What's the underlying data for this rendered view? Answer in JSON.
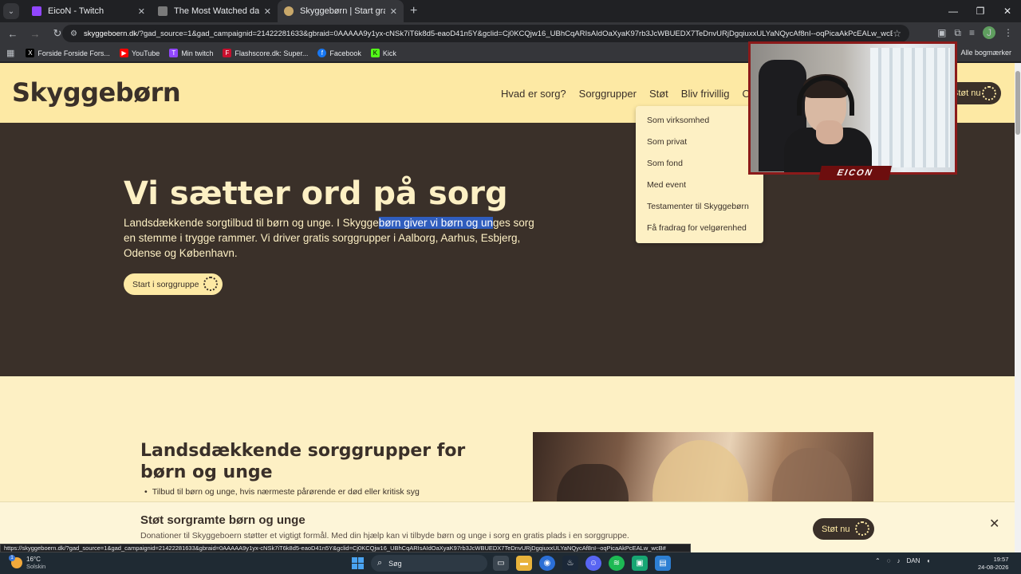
{
  "tabs": [
    {
      "title": "EicoN - Twitch",
      "favicon_color": "#9146ff"
    },
    {
      "title": "The Most Watched dansk Twitch",
      "favicon_color": "#7a7a7a"
    },
    {
      "title": "Skyggebørn | Start gratis i sorg",
      "favicon_color": "#c9a86a"
    }
  ],
  "browser": {
    "url_host": "skyggeboern.dk",
    "url_rest": "/?gad_source=1&gad_campaignid=21422281633&gbraid=0AAAAA9y1yx-cNSk7iT6k8d5-eaoD41n5Y&gclid=Cj0KCQjw16_UBhCqARIsAIdOaXyaK97rb3JcWBUEDX7TeDnvURjDgqiuxxULYaNQycAf8nI--oqPicaAkPcEALw_wcB",
    "profile_initial": "J",
    "status_url": "https://skyggeboern.dk/?gad_source=1&gad_campaignid=21422281633&gbraid=0AAAAA9y1yx-cNSk7iT6k8d5-eaoD41n5Y&gclid=Cj0KCQjw16_UBhCqARIsAIdOaXyaK97rb3JcWBUEDX7TeDnvURjDgqiuxxULYaNQycAf8nI--oqPicaAkPcEALw_wcB#"
  },
  "bookmarks": [
    {
      "label": "Forside Forside Fors...",
      "icon": "x-icon",
      "color": "#000000",
      "glyph": "X"
    },
    {
      "label": "YouTube",
      "icon": "youtube-icon",
      "color": "#ff0000",
      "glyph": "▶"
    },
    {
      "label": "Min twitch",
      "icon": "twitch-icon",
      "color": "#9146ff",
      "glyph": "T"
    },
    {
      "label": "Flashscore.dk: Super...",
      "icon": "flashscore-icon",
      "color": "#c8102e",
      "glyph": "F"
    },
    {
      "label": "Facebook",
      "icon": "facebook-icon",
      "color": "#1877f2",
      "glyph": "f"
    },
    {
      "label": "Kick",
      "icon": "kick-icon",
      "color": "#53fc18",
      "glyph": "K"
    }
  ],
  "bookmarks_all": "Alle bogmærker",
  "site": {
    "logo": "Skyggebørn",
    "nav": [
      "Hvad er sorg?",
      "Sorggrupper",
      "Støt",
      "Bliv frivillig",
      "Om"
    ],
    "header_cta": "Støt nu",
    "dropdown": [
      "Som virksomhed",
      "Som privat",
      "Som fond",
      "Med event",
      "Testamenter til Skyggebørn",
      "Få fradrag for velgørenhed"
    ],
    "hero": {
      "title": "Vi sætter ord på sorg",
      "text_before": "Landsdækkende sorgtilbud til børn og unge. I Skygge",
      "text_highlight": "børn giver vi børn og un",
      "text_after": "ges sorg en stemme i trygge rammer. Vi driver gratis sorggrupper i Aalborg, Aarhus, Esbjerg, Odense og København.",
      "button": "Start i sorggruppe"
    },
    "section2": {
      "title": "Landsdækkende sorggrupper for børn og unge",
      "bullet": "Tilbud til børn og unge, hvis nærmeste pårørende er død eller kritisk syg"
    },
    "donate_bar": {
      "title": "Støt sorgramte børn og unge",
      "text": "Donationer til Skyggeboern støtter et vigtigt formål. Med din hjælp kan vi tilbyde børn og unge i sorg en gratis plads i en sorggruppe.",
      "button": "Støt nu"
    }
  },
  "webcam": {
    "label": "EICON"
  },
  "taskbar": {
    "temp": "16°C",
    "weather": "Solskin",
    "weather_badge": "1",
    "search": "Søg",
    "lang": "DAN",
    "time": "19:57",
    "date": "24-08-2026"
  }
}
